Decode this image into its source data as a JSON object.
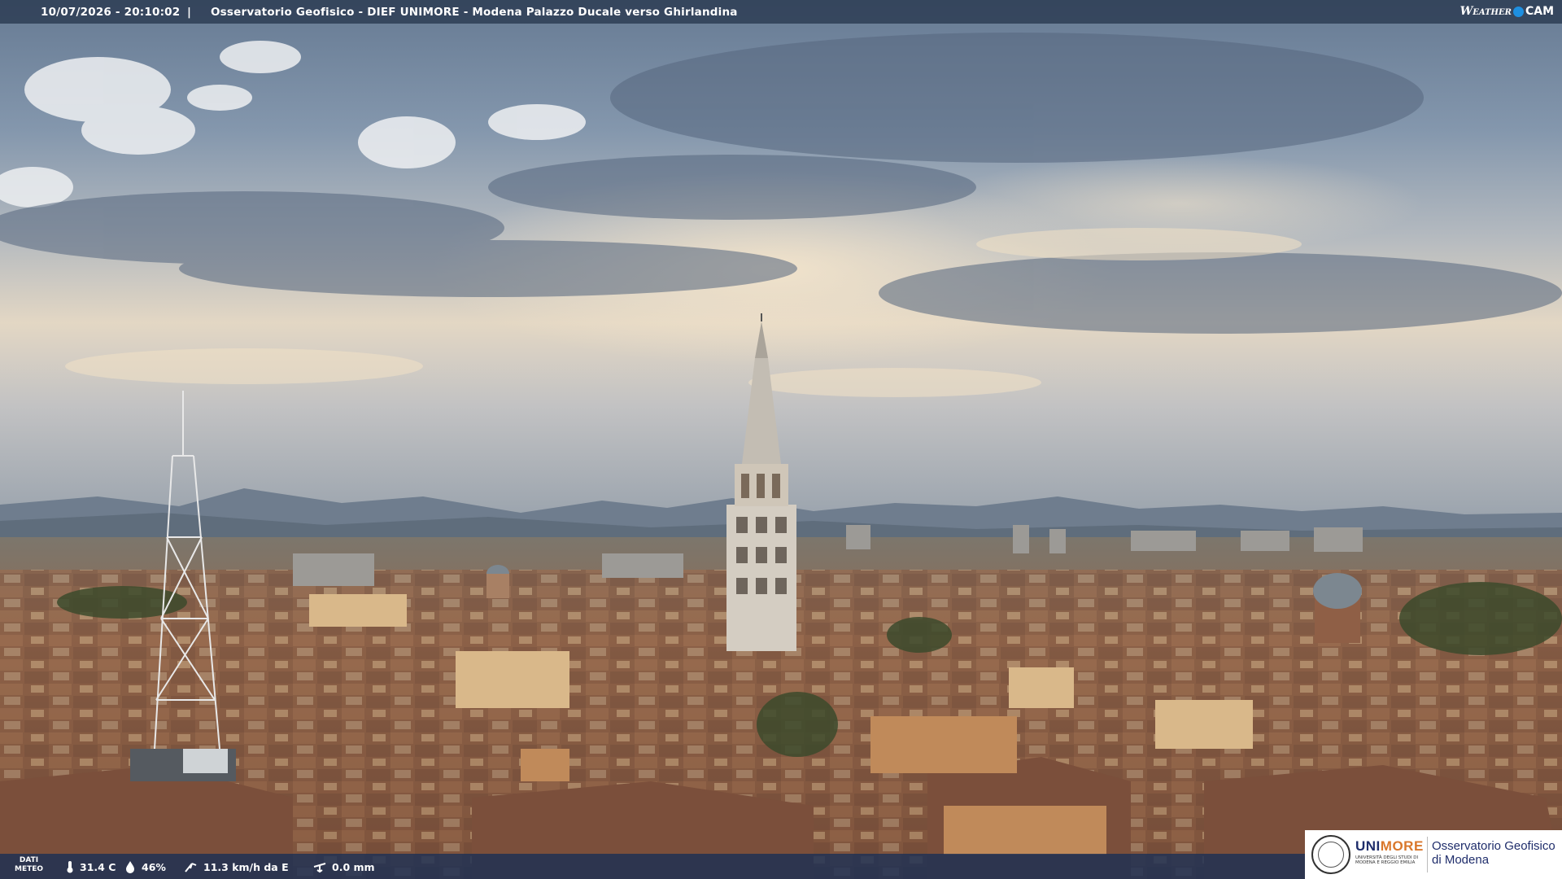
{
  "overlay": {
    "timestamp": "10/07/2026 - 20:10:02",
    "separator": "|",
    "location": "Osservatorio Geofisico - DIEF UNIMORE - Modena Palazzo Ducale verso Ghirlandina"
  },
  "brand": {
    "weather": "Weather",
    "cam": "CAM",
    "accent": "#1e8fe0"
  },
  "meteo": {
    "label_line1": "DATI",
    "label_line2": "METEO",
    "temperature": "31.4 C",
    "humidity": "46%",
    "wind": "11.3 km/h da E",
    "rain": "0.0 mm"
  },
  "logo": {
    "unimore_u": "UNI",
    "unimore_m": "MORE",
    "university_line1": "UNIVERSITÀ DEGLI STUDI DI",
    "university_line2": "MODENA E REGGIO EMILIA",
    "observatory_line1": "Osservatorio Geofisico",
    "observatory_line2": "di Modena"
  },
  "colors": {
    "top_bar": "#28374e",
    "bottom_bar": "#1c3054",
    "unimore_blue": "#1f2d6b",
    "unimore_orange": "#d9772b"
  }
}
